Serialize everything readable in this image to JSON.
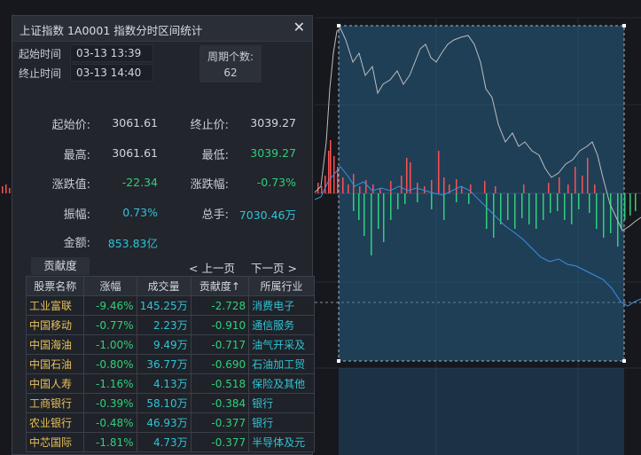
{
  "dialog": {
    "title": "上证指数  1A0001  指数分时区间统计",
    "close_label": "✕",
    "start_label": "起始时间",
    "start_value": "03-13 13:39",
    "end_label": "终止时间",
    "end_value": "03-13 14:40",
    "count_label": "周期个数:",
    "count_value": "62",
    "stats": [
      {
        "label": "起始价:",
        "value": "3061.61",
        "color": "#d2d6dd"
      },
      {
        "label": "终止价:",
        "value": "3039.27",
        "color": "#d2d6dd"
      },
      {
        "label": "最高:",
        "value": "3061.61",
        "color": "#d2d6dd"
      },
      {
        "label": "最低:",
        "value": "3039.27",
        "color": "#2fd07a"
      },
      {
        "label": "涨跌值:",
        "value": "-22.34",
        "color": "#2fd07a"
      },
      {
        "label": "涨跌幅:",
        "value": "-0.73%",
        "color": "#2fd07a"
      },
      {
        "label": "振幅:",
        "value": "0.73%",
        "color": "#2fc4d7"
      },
      {
        "label": "总手:",
        "value": "7030.46万",
        "color": "#2fc4d7"
      },
      {
        "label": "金额:",
        "value": "853.83亿",
        "color": "#2fc4d7"
      }
    ],
    "tab_label": "贡献度",
    "prev_label": "< 上一页",
    "next_label": "下一页 >",
    "columns": [
      "股票名称",
      "涨幅",
      "成交量",
      "贡献度↑",
      "所属行业"
    ],
    "rows": [
      [
        "工业富联",
        "-9.46%",
        "145.25万",
        "-2.728",
        "消费电子"
      ],
      [
        "中国移动",
        "-0.77%",
        "2.23万",
        "-0.910",
        "通信服务"
      ],
      [
        "中国海油",
        "-1.00%",
        "9.49万",
        "-0.717",
        "油气开采及"
      ],
      [
        "中国石油",
        "-0.80%",
        "36.77万",
        "-0.690",
        "石油加工贸"
      ],
      [
        "中国人寿",
        "-1.16%",
        "4.13万",
        "-0.518",
        "保险及其他"
      ],
      [
        "工商银行",
        "-0.39%",
        "58.10万",
        "-0.384",
        "银行"
      ],
      [
        "农业银行",
        "-0.48%",
        "46.93万",
        "-0.377",
        "银行"
      ],
      [
        "中芯国际",
        "-1.81%",
        "4.73万",
        "-0.377",
        "半导体及元"
      ]
    ]
  },
  "colors": {
    "rise": "#ff5050",
    "fall": "#2fd07a",
    "cyan": "#2fc4d7",
    "stock_name": "#e8c05a",
    "price_line": "#c0c0c0",
    "avg_line": "#3aa0ff",
    "selection": "#2a6fa0"
  }
}
